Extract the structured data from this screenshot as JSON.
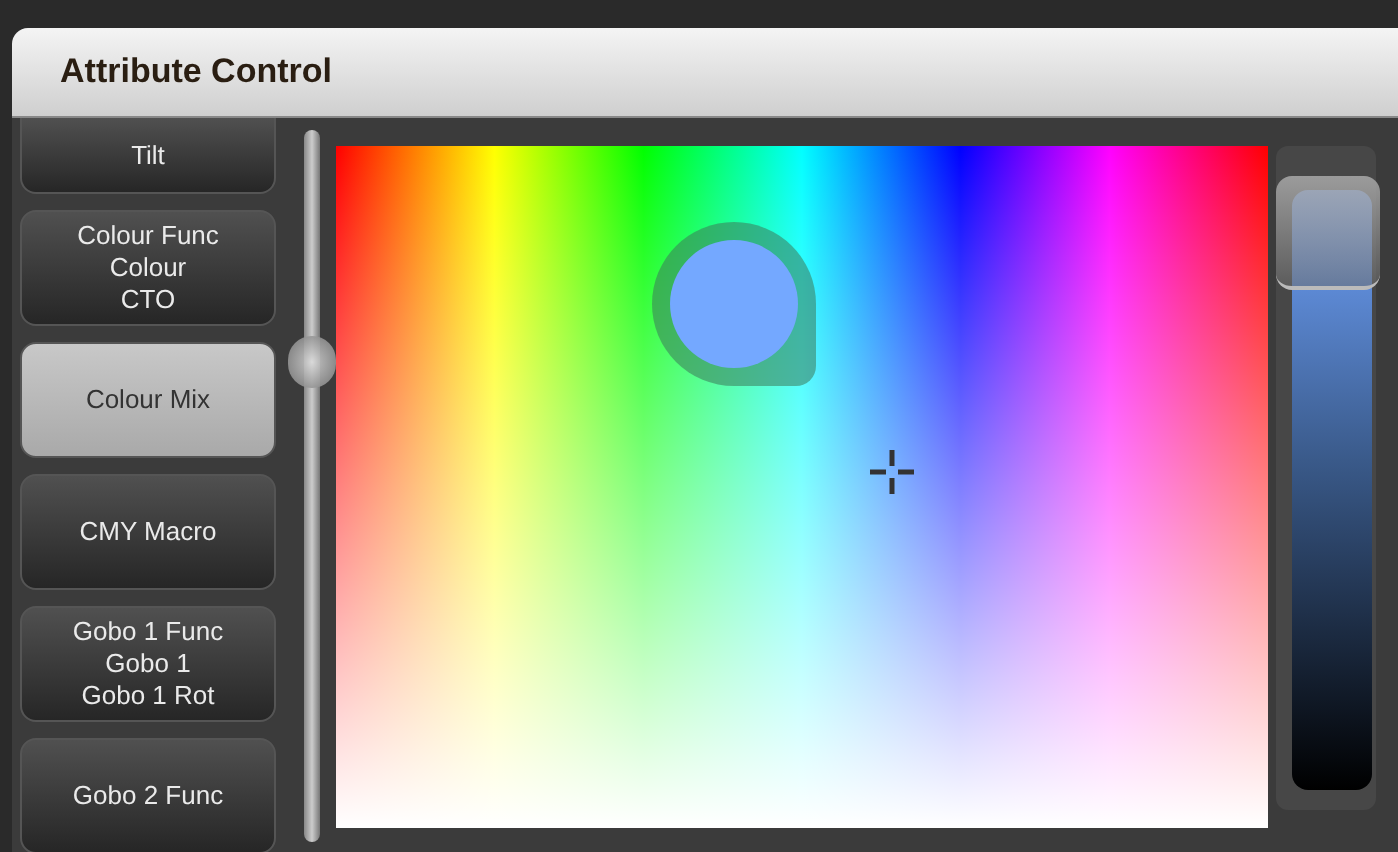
{
  "window": {
    "title": "Attribute Control"
  },
  "attributes": [
    {
      "label": "Tilt",
      "selected": false
    },
    {
      "label": "Colour Func\nColour\nCTO",
      "selected": false
    },
    {
      "label": "Colour Mix",
      "selected": true
    },
    {
      "label": "CMY Macro",
      "selected": false
    },
    {
      "label": "Gobo 1 Func\nGobo 1\nGobo 1 Rot",
      "selected": false
    },
    {
      "label": "Gobo 2 Func",
      "selected": false
    }
  ],
  "intensity_slider": {
    "level": 0.95
  }
}
